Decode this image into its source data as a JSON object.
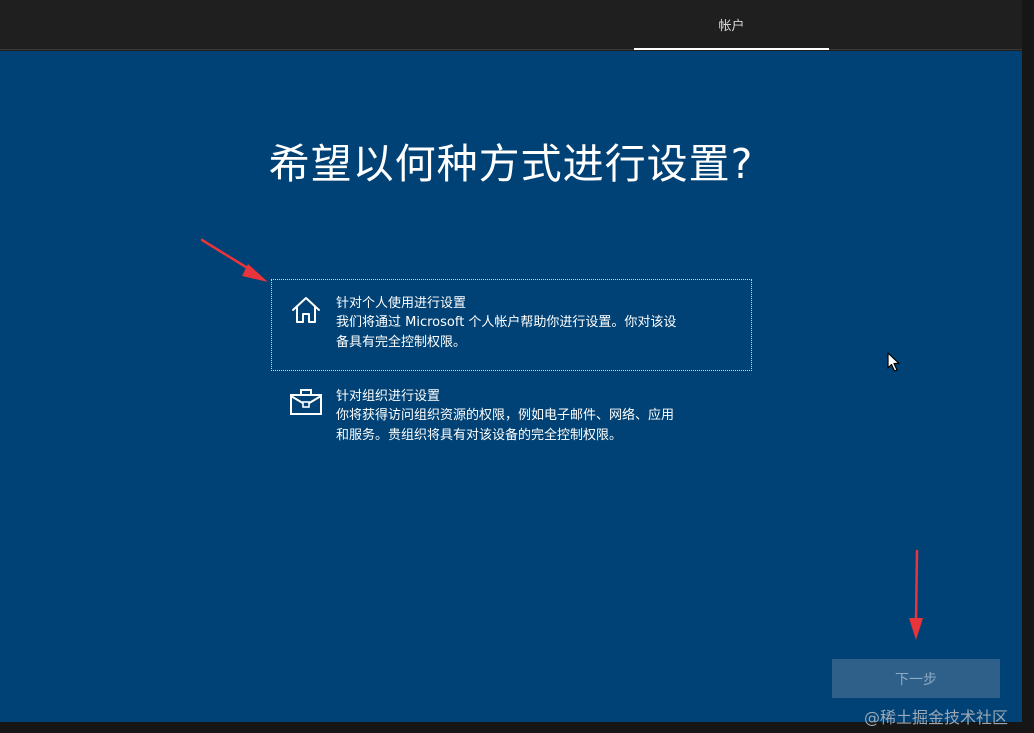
{
  "header": {
    "active_tab": "帐户"
  },
  "main": {
    "title": "希望以何种方式进行设置?",
    "options": [
      {
        "icon": "home-icon",
        "title": "针对个人使用进行设置",
        "desc_line1": "我们将通过 Microsoft 个人帐户帮助你进行设置。你对该设",
        "desc_line2": "备具有完全控制权限。",
        "selected": true
      },
      {
        "icon": "briefcase-icon",
        "title": "针对组织进行设置",
        "desc_line1": "你将获得访问组织资源的权限，例如电子邮件、网络、应用",
        "desc_line2": "和服务。贵组织将具有对该设备的完全控制权限。",
        "selected": false
      }
    ],
    "next_label": "下一步"
  },
  "watermark": "@稀土掘金技术社区",
  "colors": {
    "background": "#004275",
    "topbar": "#1f1f1f",
    "annotation_arrow": "#e8343a",
    "next_disabled": "#2e6089"
  }
}
